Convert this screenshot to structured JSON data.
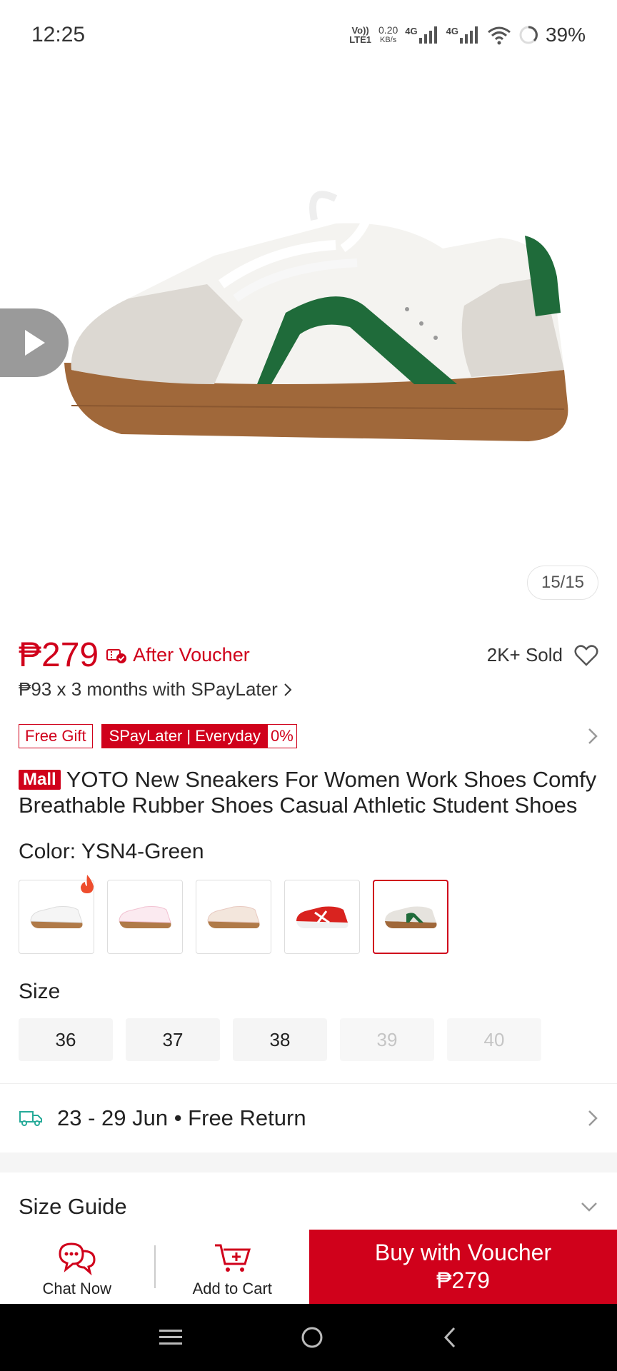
{
  "status_bar": {
    "time": "12:25",
    "volte_top": "Vo))",
    "volte_bottom": "LTE1",
    "net_speed_value": "0.20",
    "net_speed_unit": "KB/s",
    "sig1_label": "4G",
    "sig2_label": "4G",
    "battery": "39%"
  },
  "gallery": {
    "counter": "15/15"
  },
  "price": {
    "value": "₱279",
    "after_voucher": "After Voucher",
    "sold": "2K+ Sold",
    "installment": "₱93 x 3 months with SPayLater"
  },
  "badges": {
    "free_gift": "Free Gift",
    "spaylater": "SPayLater | Everyday",
    "spaylater_rate": "0%"
  },
  "product": {
    "mall_tag": "Mall",
    "title": "YOTO New Sneakers For Women Work Shoes Comfy Breathable Rubber Shoes Casual Athletic Student Shoes"
  },
  "color": {
    "label": "Color: YSN4-Green",
    "options": [
      {
        "name": "white-gum",
        "hot": true,
        "selected": false
      },
      {
        "name": "pink",
        "hot": false,
        "selected": false
      },
      {
        "name": "beige-pink",
        "hot": false,
        "selected": false
      },
      {
        "name": "red",
        "hot": false,
        "selected": false
      },
      {
        "name": "green",
        "hot": false,
        "selected": true
      }
    ]
  },
  "size": {
    "label": "Size",
    "options": [
      {
        "label": "36",
        "available": true
      },
      {
        "label": "37",
        "available": true
      },
      {
        "label": "38",
        "available": true
      },
      {
        "label": "39",
        "available": false
      },
      {
        "label": "40",
        "available": false
      }
    ]
  },
  "delivery": {
    "text": "23 - 29 Jun • Free Return"
  },
  "size_guide": {
    "label": "Size Guide"
  },
  "actions": {
    "chat": "Chat Now",
    "cart": "Add to Cart",
    "buy_line1": "Buy with Voucher",
    "buy_line2": "₱279"
  },
  "colors": {
    "brand_red": "#d0011b",
    "teal_icon": "#26aa99"
  }
}
